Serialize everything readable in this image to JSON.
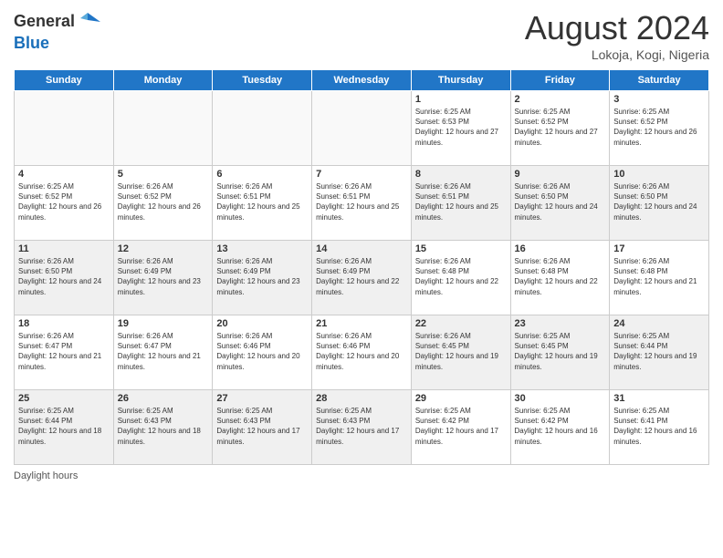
{
  "header": {
    "logo_general": "General",
    "logo_blue": "Blue",
    "month_year": "August 2024",
    "location": "Lokoja, Kogi, Nigeria"
  },
  "days_of_week": [
    "Sunday",
    "Monday",
    "Tuesday",
    "Wednesday",
    "Thursday",
    "Friday",
    "Saturday"
  ],
  "footer": {
    "daylight_label": "Daylight hours"
  },
  "weeks": [
    [
      {
        "day": "",
        "info": ""
      },
      {
        "day": "",
        "info": ""
      },
      {
        "day": "",
        "info": ""
      },
      {
        "day": "",
        "info": ""
      },
      {
        "day": "1",
        "info": "Sunrise: 6:25 AM\nSunset: 6:53 PM\nDaylight: 12 hours and 27 minutes."
      },
      {
        "day": "2",
        "info": "Sunrise: 6:25 AM\nSunset: 6:52 PM\nDaylight: 12 hours and 27 minutes."
      },
      {
        "day": "3",
        "info": "Sunrise: 6:25 AM\nSunset: 6:52 PM\nDaylight: 12 hours and 26 minutes."
      }
    ],
    [
      {
        "day": "4",
        "info": "Sunrise: 6:25 AM\nSunset: 6:52 PM\nDaylight: 12 hours and 26 minutes."
      },
      {
        "day": "5",
        "info": "Sunrise: 6:26 AM\nSunset: 6:52 PM\nDaylight: 12 hours and 26 minutes."
      },
      {
        "day": "6",
        "info": "Sunrise: 6:26 AM\nSunset: 6:51 PM\nDaylight: 12 hours and 25 minutes."
      },
      {
        "day": "7",
        "info": "Sunrise: 6:26 AM\nSunset: 6:51 PM\nDaylight: 12 hours and 25 minutes."
      },
      {
        "day": "8",
        "info": "Sunrise: 6:26 AM\nSunset: 6:51 PM\nDaylight: 12 hours and 25 minutes."
      },
      {
        "day": "9",
        "info": "Sunrise: 6:26 AM\nSunset: 6:50 PM\nDaylight: 12 hours and 24 minutes."
      },
      {
        "day": "10",
        "info": "Sunrise: 6:26 AM\nSunset: 6:50 PM\nDaylight: 12 hours and 24 minutes."
      }
    ],
    [
      {
        "day": "11",
        "info": "Sunrise: 6:26 AM\nSunset: 6:50 PM\nDaylight: 12 hours and 24 minutes."
      },
      {
        "day": "12",
        "info": "Sunrise: 6:26 AM\nSunset: 6:49 PM\nDaylight: 12 hours and 23 minutes."
      },
      {
        "day": "13",
        "info": "Sunrise: 6:26 AM\nSunset: 6:49 PM\nDaylight: 12 hours and 23 minutes."
      },
      {
        "day": "14",
        "info": "Sunrise: 6:26 AM\nSunset: 6:49 PM\nDaylight: 12 hours and 22 minutes."
      },
      {
        "day": "15",
        "info": "Sunrise: 6:26 AM\nSunset: 6:48 PM\nDaylight: 12 hours and 22 minutes."
      },
      {
        "day": "16",
        "info": "Sunrise: 6:26 AM\nSunset: 6:48 PM\nDaylight: 12 hours and 22 minutes."
      },
      {
        "day": "17",
        "info": "Sunrise: 6:26 AM\nSunset: 6:48 PM\nDaylight: 12 hours and 21 minutes."
      }
    ],
    [
      {
        "day": "18",
        "info": "Sunrise: 6:26 AM\nSunset: 6:47 PM\nDaylight: 12 hours and 21 minutes."
      },
      {
        "day": "19",
        "info": "Sunrise: 6:26 AM\nSunset: 6:47 PM\nDaylight: 12 hours and 21 minutes."
      },
      {
        "day": "20",
        "info": "Sunrise: 6:26 AM\nSunset: 6:46 PM\nDaylight: 12 hours and 20 minutes."
      },
      {
        "day": "21",
        "info": "Sunrise: 6:26 AM\nSunset: 6:46 PM\nDaylight: 12 hours and 20 minutes."
      },
      {
        "day": "22",
        "info": "Sunrise: 6:26 AM\nSunset: 6:45 PM\nDaylight: 12 hours and 19 minutes."
      },
      {
        "day": "23",
        "info": "Sunrise: 6:25 AM\nSunset: 6:45 PM\nDaylight: 12 hours and 19 minutes."
      },
      {
        "day": "24",
        "info": "Sunrise: 6:25 AM\nSunset: 6:44 PM\nDaylight: 12 hours and 19 minutes."
      }
    ],
    [
      {
        "day": "25",
        "info": "Sunrise: 6:25 AM\nSunset: 6:44 PM\nDaylight: 12 hours and 18 minutes."
      },
      {
        "day": "26",
        "info": "Sunrise: 6:25 AM\nSunset: 6:43 PM\nDaylight: 12 hours and 18 minutes."
      },
      {
        "day": "27",
        "info": "Sunrise: 6:25 AM\nSunset: 6:43 PM\nDaylight: 12 hours and 17 minutes."
      },
      {
        "day": "28",
        "info": "Sunrise: 6:25 AM\nSunset: 6:43 PM\nDaylight: 12 hours and 17 minutes."
      },
      {
        "day": "29",
        "info": "Sunrise: 6:25 AM\nSunset: 6:42 PM\nDaylight: 12 hours and 17 minutes."
      },
      {
        "day": "30",
        "info": "Sunrise: 6:25 AM\nSunset: 6:42 PM\nDaylight: 12 hours and 16 minutes."
      },
      {
        "day": "31",
        "info": "Sunrise: 6:25 AM\nSunset: 6:41 PM\nDaylight: 12 hours and 16 minutes."
      }
    ]
  ]
}
